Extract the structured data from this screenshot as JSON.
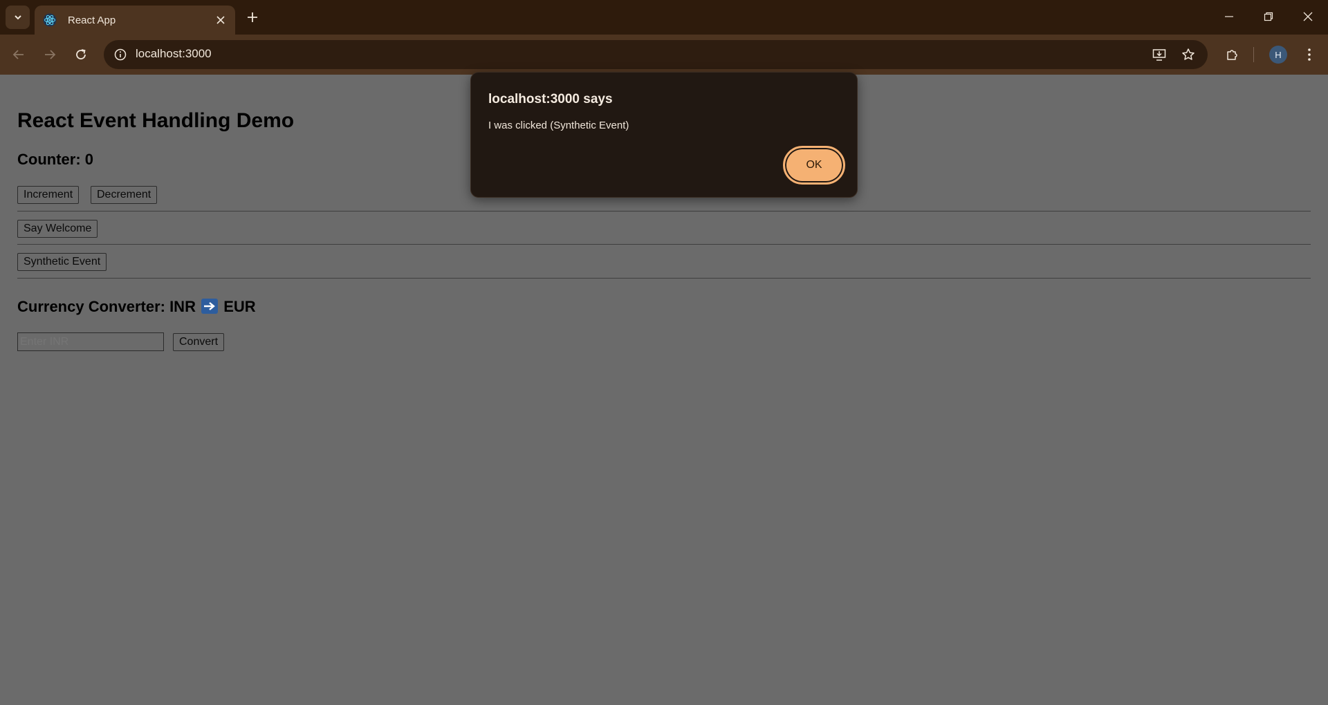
{
  "browser": {
    "tab_title": "React App",
    "url": "localhost:3000",
    "profile_initial": "H",
    "icons": {
      "tab_search": "chevron-down-icon",
      "favicon": "react-logo-icon",
      "tab_close": "close-icon",
      "new_tab": "plus-icon",
      "minimize": "minimize-icon",
      "restore": "restore-icon",
      "close_window": "close-icon",
      "back": "back-arrow-icon",
      "forward": "forward-arrow-icon",
      "reload": "reload-icon",
      "site_info": "info-icon",
      "install": "install-app-icon",
      "bookmark": "star-icon",
      "extensions": "puzzle-icon",
      "menu": "kebab-menu-icon"
    }
  },
  "page": {
    "title": "React Event Handling Demo",
    "counter_label": "Counter: 0",
    "increment_label": "Increment",
    "decrement_label": "Decrement",
    "say_welcome_label": "Say Welcome",
    "synthetic_event_label": "Synthetic Event",
    "converter_prefix": "Currency Converter: INR",
    "converter_suffix": "EUR",
    "converter_arrow_icon": "right-arrow-emoji-icon",
    "inr_placeholder": "Enter INR",
    "convert_label": "Convert"
  },
  "dialog": {
    "title": "localhost:3000 says",
    "message": "I was clicked (Synthetic Event)",
    "ok_label": "OK"
  },
  "colors": {
    "chrome_dark": "#2e1b0c",
    "chrome_toolbar": "#4d3420",
    "dialog_bg": "#211812",
    "ok_button": "#f5b173",
    "page_overlay": "#6b6b6b"
  }
}
